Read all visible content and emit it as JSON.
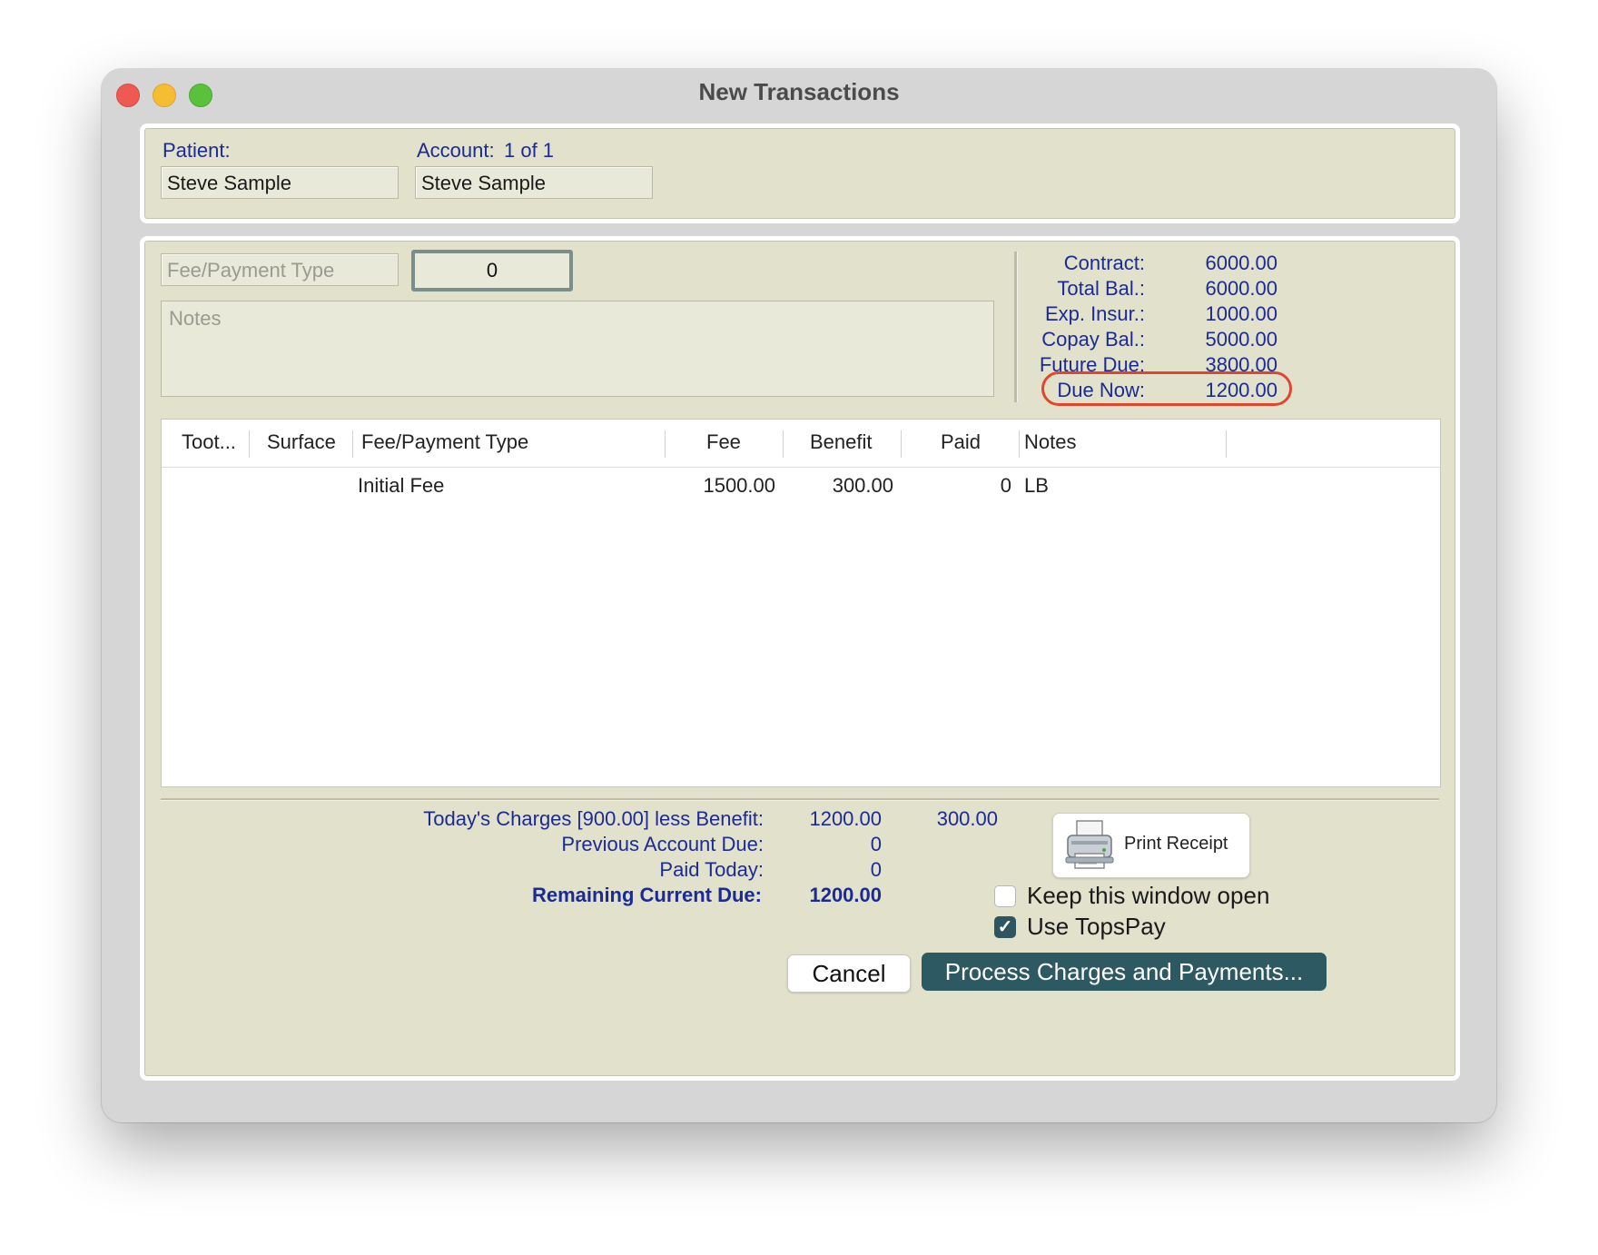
{
  "window": {
    "title": "New Transactions"
  },
  "patient": {
    "label": "Patient:",
    "value": "Steve Sample"
  },
  "account": {
    "label": "Account:",
    "index": "1 of 1",
    "value": "Steve Sample"
  },
  "entry": {
    "fee_type_placeholder": "Fee/Payment Type",
    "amount_value": "0",
    "notes_placeholder": "Notes"
  },
  "summary": [
    {
      "label": "Contract:",
      "value": "6000.00"
    },
    {
      "label": "Total Bal.:",
      "value": "6000.00"
    },
    {
      "label": "Exp. Insur.:",
      "value": "1000.00"
    },
    {
      "label": "Copay Bal.:",
      "value": "5000.00"
    },
    {
      "label": "Future Due:",
      "value": "3800.00"
    },
    {
      "label": "Due Now:",
      "value": "1200.00"
    }
  ],
  "highlight_color": "#e0462c",
  "table": {
    "columns": [
      "Toot...",
      "Surface",
      "Fee/Payment Type",
      "Fee",
      "Benefit",
      "Paid",
      "Notes"
    ],
    "rows": [
      {
        "tooth": "",
        "surface": "",
        "type": "Initial Fee",
        "fee": "1500.00",
        "benefit": "300.00",
        "paid": "0",
        "notes": "LB"
      }
    ]
  },
  "totals": {
    "charges_label": "Today's Charges [900.00] less Benefit:",
    "charges_value": "1200.00",
    "benefit_value": "300.00",
    "previous_label": "Previous Account Due:",
    "previous_value": "0",
    "paid_label": "Paid Today:",
    "paid_value": "0",
    "remaining_label": "Remaining Current Due:",
    "remaining_value": "1200.00"
  },
  "actions": {
    "print_receipt": "Print Receipt",
    "keep_open_label": "Keep this window open",
    "keep_open_checked": false,
    "topspay_label": "Use TopsPay",
    "topspay_checked": true,
    "cancel": "Cancel",
    "process": "Process Charges and Payments..."
  },
  "colors": {
    "panel": "#e1e1cc",
    "label_blue": "#1c2a96",
    "primary_button": "#2d5962"
  }
}
